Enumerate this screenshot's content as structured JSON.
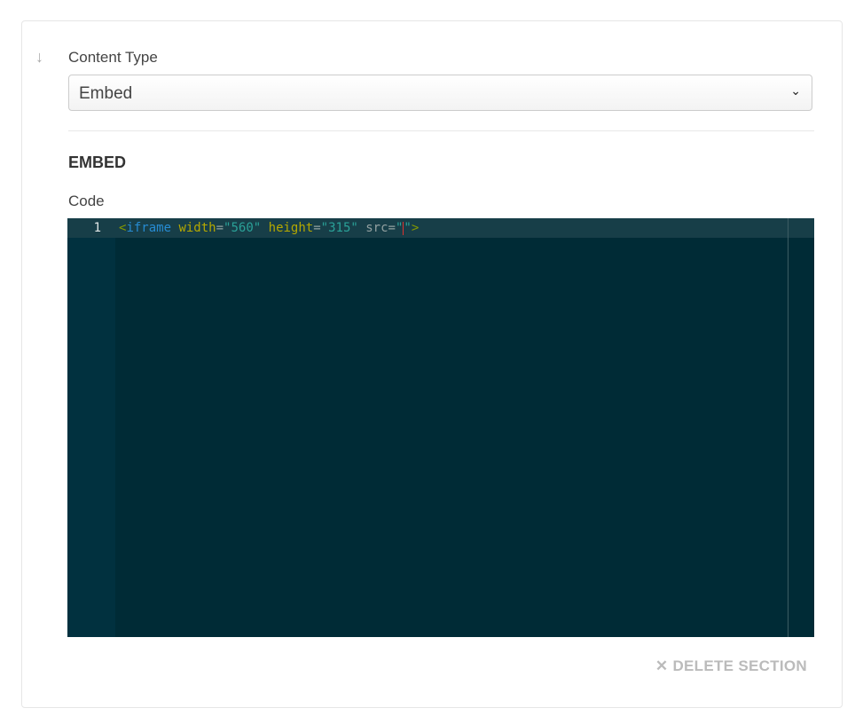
{
  "form": {
    "drag_icon": "arrow-down-icon",
    "content_type_label": "Content Type",
    "content_type_value": "Embed",
    "section_title": "EMBED",
    "code_label": "Code",
    "editor": {
      "line_number": "1",
      "tokens": {
        "open": "<",
        "tag": "iframe",
        "attr1": "width",
        "eq1": "=",
        "val1": "\"560\"",
        "attr2": "height",
        "eq2": "=",
        "val2": "\"315\"",
        "attr3": "src",
        "eq3": "=",
        "q1": "\"",
        "q2": "\"",
        "close": ">"
      }
    },
    "delete_label": "DELETE SECTION"
  }
}
